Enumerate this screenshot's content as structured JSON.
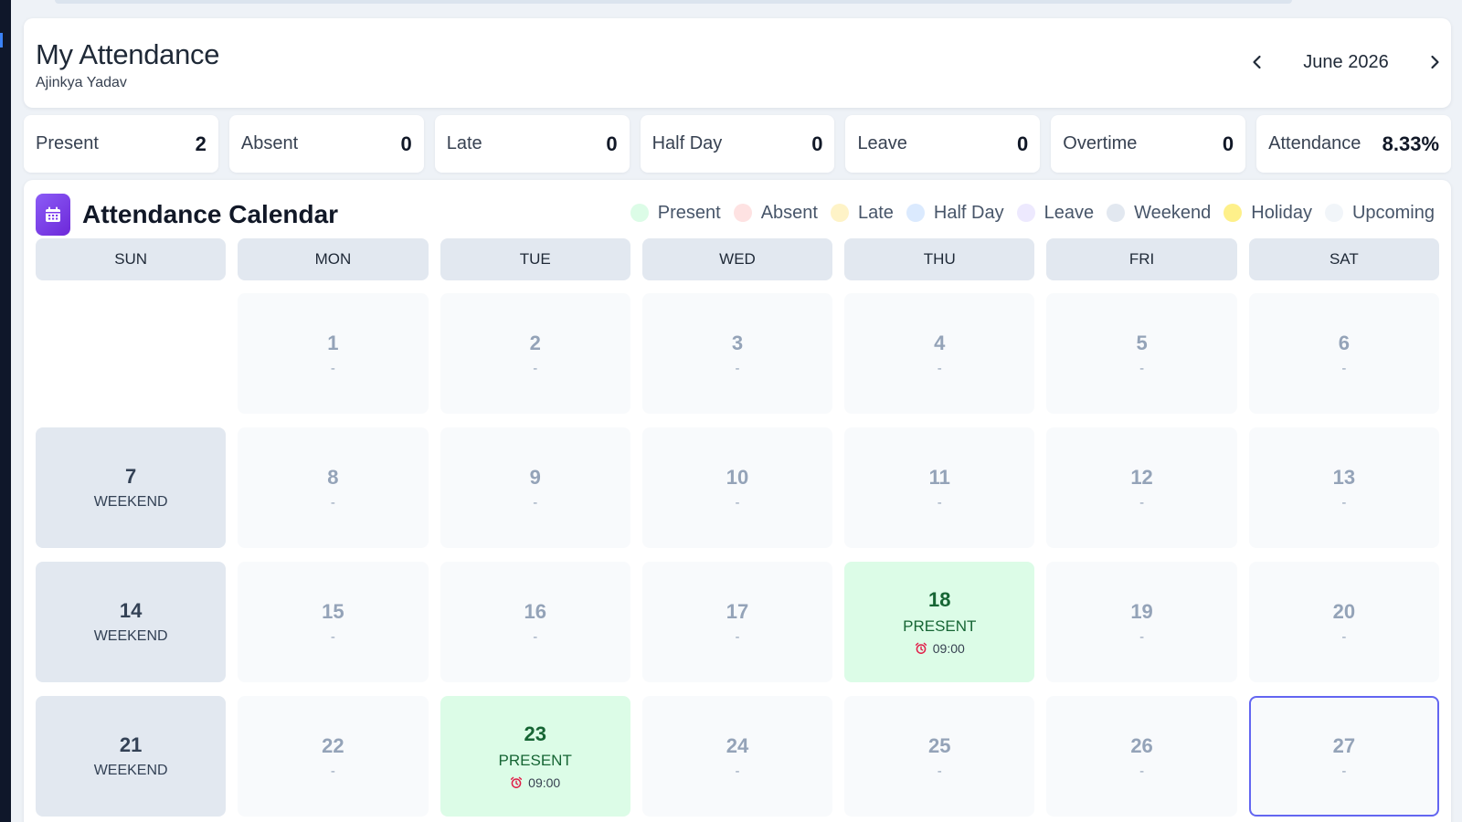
{
  "header": {
    "title": "My Attendance",
    "subtitle": "Ajinkya Yadav",
    "month": "June 2026"
  },
  "stats": [
    {
      "label": "Present",
      "value": "2"
    },
    {
      "label": "Absent",
      "value": "0"
    },
    {
      "label": "Late",
      "value": "0"
    },
    {
      "label": "Half Day",
      "value": "0"
    },
    {
      "label": "Leave",
      "value": "0"
    },
    {
      "label": "Overtime",
      "value": "0"
    },
    {
      "label": "Attendance",
      "value": "8.33%"
    }
  ],
  "calendar": {
    "title": "Attendance Calendar",
    "legend": [
      {
        "label": "Present",
        "color": "#dcfce7"
      },
      {
        "label": "Absent",
        "color": "#fee2e2"
      },
      {
        "label": "Late",
        "color": "#fef3c7"
      },
      {
        "label": "Half Day",
        "color": "#dbeafe"
      },
      {
        "label": "Leave",
        "color": "#ede9fe"
      },
      {
        "label": "Weekend",
        "color": "#e2e8f0"
      },
      {
        "label": "Holiday",
        "color": "#fef08a"
      },
      {
        "label": "Upcoming",
        "color": "#f1f5f9"
      }
    ],
    "weekdays": [
      "SUN",
      "MON",
      "TUE",
      "WED",
      "THU",
      "FRI",
      "SAT"
    ],
    "days": [
      {
        "type": "empty"
      },
      {
        "day": "1",
        "status": "-",
        "type": "upcoming"
      },
      {
        "day": "2",
        "status": "-",
        "type": "upcoming"
      },
      {
        "day": "3",
        "status": "-",
        "type": "upcoming"
      },
      {
        "day": "4",
        "status": "-",
        "type": "upcoming"
      },
      {
        "day": "5",
        "status": "-",
        "type": "upcoming"
      },
      {
        "day": "6",
        "status": "-",
        "type": "upcoming"
      },
      {
        "day": "7",
        "status": "WEEKEND",
        "type": "weekend"
      },
      {
        "day": "8",
        "status": "-",
        "type": "upcoming"
      },
      {
        "day": "9",
        "status": "-",
        "type": "upcoming"
      },
      {
        "day": "10",
        "status": "-",
        "type": "upcoming"
      },
      {
        "day": "11",
        "status": "-",
        "type": "upcoming"
      },
      {
        "day": "12",
        "status": "-",
        "type": "upcoming"
      },
      {
        "day": "13",
        "status": "-",
        "type": "upcoming"
      },
      {
        "day": "14",
        "status": "WEEKEND",
        "type": "weekend"
      },
      {
        "day": "15",
        "status": "-",
        "type": "upcoming"
      },
      {
        "day": "16",
        "status": "-",
        "type": "upcoming"
      },
      {
        "day": "17",
        "status": "-",
        "type": "upcoming"
      },
      {
        "day": "18",
        "status": "PRESENT",
        "type": "present",
        "time": "09:00"
      },
      {
        "day": "19",
        "status": "-",
        "type": "upcoming"
      },
      {
        "day": "20",
        "status": "-",
        "type": "upcoming"
      },
      {
        "day": "21",
        "status": "WEEKEND",
        "type": "weekend"
      },
      {
        "day": "22",
        "status": "-",
        "type": "upcoming"
      },
      {
        "day": "23",
        "status": "PRESENT",
        "type": "present",
        "time": "09:00"
      },
      {
        "day": "24",
        "status": "-",
        "type": "upcoming"
      },
      {
        "day": "25",
        "status": "-",
        "type": "upcoming"
      },
      {
        "day": "26",
        "status": "-",
        "type": "upcoming"
      },
      {
        "day": "27",
        "status": "-",
        "type": "today"
      }
    ]
  },
  "icons": {
    "prev": "chevron-left-icon",
    "next": "chevron-right-icon",
    "calendar": "calendar-icon",
    "clock": "alarm-clock-icon"
  }
}
